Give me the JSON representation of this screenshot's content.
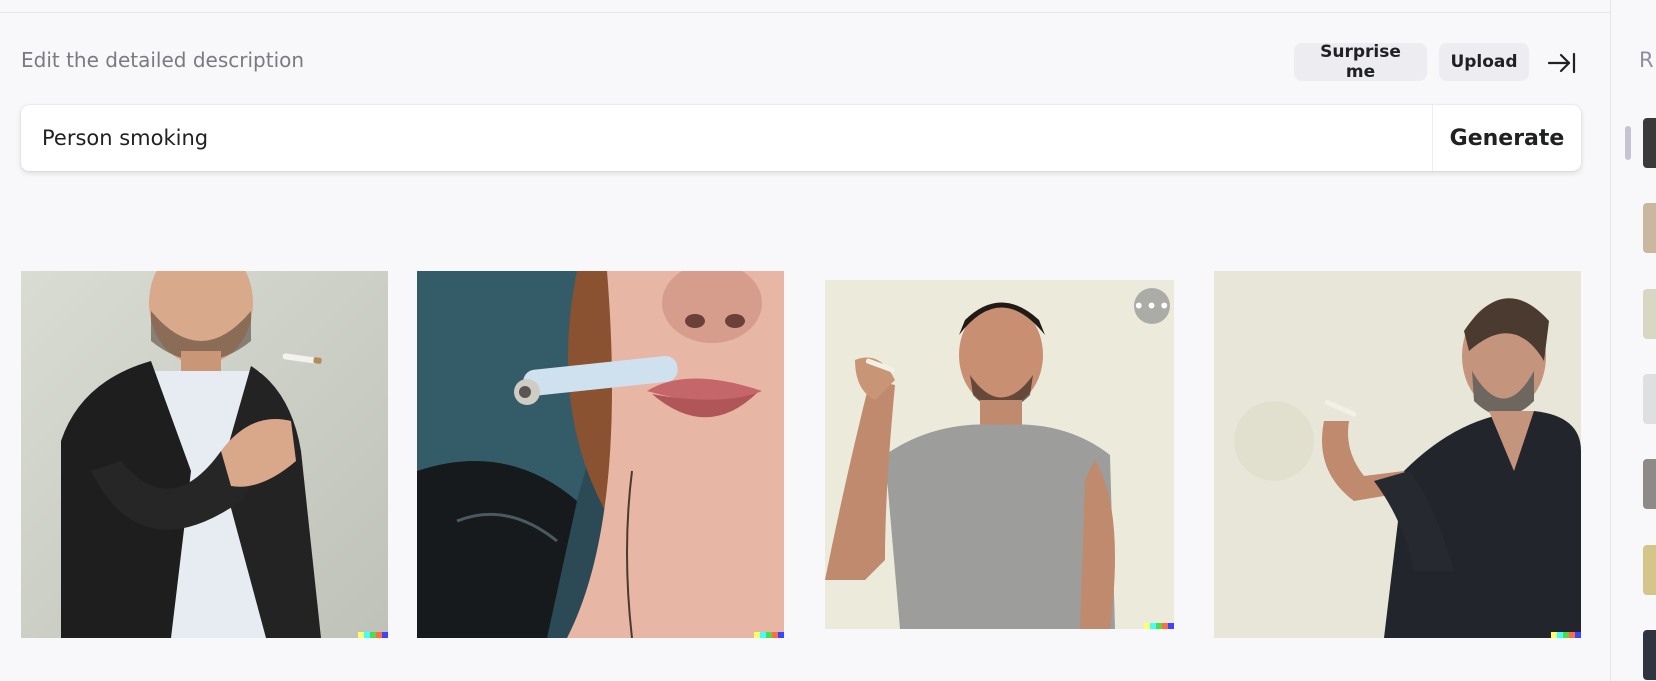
{
  "header": {
    "title": "Edit the detailed description",
    "surprise_label": "Surprise me",
    "upload_label": "Upload"
  },
  "prompt": {
    "value": "Person smoking",
    "generate_label": "Generate"
  },
  "images": [
    {
      "subject": "man in black blazer lighting cigarette",
      "watermark": true
    },
    {
      "subject": "close-up of woman's lips holding cigarette",
      "watermark": true
    },
    {
      "subject": "man in grey t-shirt holding cigarette",
      "watermark": true,
      "has_more_menu": true
    },
    {
      "subject": "older man in dark shirt holding cigarette",
      "watermark": true
    }
  ],
  "history_rail": {
    "title": "R",
    "thumbnail_count": 7
  },
  "colors": {
    "background": "#f8f8fa",
    "button_bg": "#ececf1",
    "watermark": [
      "#ffff66",
      "#42ffff",
      "#51da4c",
      "#ff6e3c",
      "#3c46ff"
    ]
  }
}
